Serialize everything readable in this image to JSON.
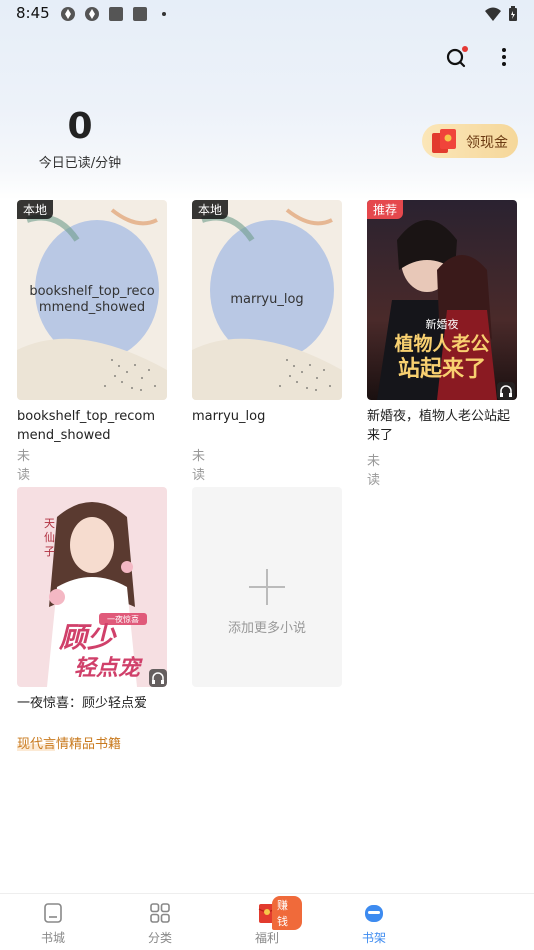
{
  "status_bar": {
    "time": "8:45"
  },
  "header": {
    "today_minutes": "0",
    "today_label": "今日已读/分钟",
    "cash_button_label": "领现金"
  },
  "books": [
    {
      "badge": "本地",
      "cover_text": "bookshelf_top_recommend_showed",
      "title": "bookshelf_top_recommend_showed",
      "status": "未读"
    },
    {
      "badge": "本地",
      "cover_text": "marryu_log",
      "title": "marryu_log",
      "status": "未读"
    },
    {
      "badge": "推荐",
      "cover_title_art": "新婚夜 植物人老公站起来了",
      "title": "新婚夜，植物人老公站起来了",
      "status": "未读"
    },
    {
      "cover_title_art": "顾少轻点宠",
      "title": "一夜惊喜：顾少轻点爱"
    }
  ],
  "add_more_label": "添加更多小说",
  "promo_text": "现代言情精品书籍",
  "tabs": [
    {
      "label": "书城",
      "icon": "bookstore-icon"
    },
    {
      "label": "分类",
      "icon": "category-grid-icon"
    },
    {
      "label": "福利",
      "icon": "red-envelope-icon",
      "badge": "赚钱"
    },
    {
      "label": "书架",
      "icon": "bookshelf-icon"
    }
  ],
  "colors": {
    "accent": "#3d8bf0",
    "promo": "#c97a1e",
    "cash_button": "#f5d79a",
    "recommend_badge": "#e5484d"
  }
}
